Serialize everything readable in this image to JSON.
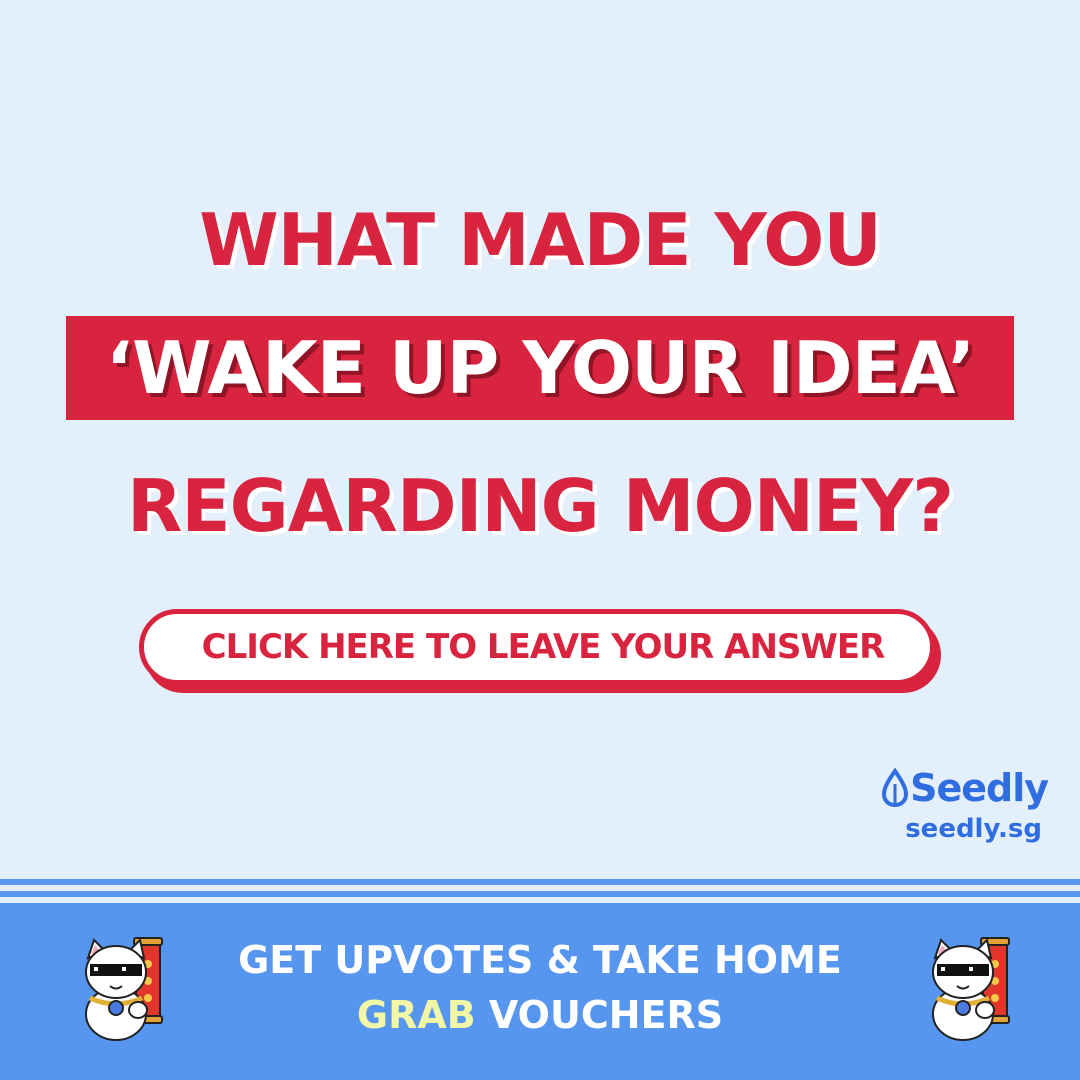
{
  "headline": {
    "line1": "WHAT MADE YOU",
    "line2": "‘WAKE UP YOUR IDEA’",
    "line3": "REGARDING MONEY?"
  },
  "cta": {
    "label": "CLICK HERE TO LEAVE YOUR ANSWER"
  },
  "brand": {
    "name": "Seedly",
    "url": "seedly.sg",
    "icon": "seed-drop-icon"
  },
  "footer": {
    "line1": "GET UPVOTES & TAKE HOME",
    "line2_accent": "GRAB",
    "line2_rest": " VOUCHERS",
    "icon": "lucky-cat-icon"
  },
  "colors": {
    "background": "#e3effb",
    "primary_red": "#d9243f",
    "brand_blue": "#2f6de0",
    "footer_blue": "#5696ee",
    "accent_yellow": "#f2f7a8"
  }
}
